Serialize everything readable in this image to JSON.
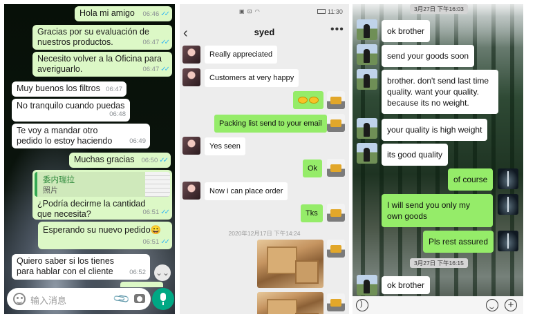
{
  "whatsapp": {
    "messages": [
      {
        "text": "Hola mi amigo",
        "time": "06:46",
        "read": true
      },
      {
        "text": "Gracias por su evaluación de nuestros productos.",
        "time": "06:47",
        "read": true
      },
      {
        "text": "Necesito volver a la Oficina para averiguarlo.",
        "time": "06:47",
        "read": true
      },
      {
        "text": "Muy buenos los filtros",
        "time": "06:47"
      },
      {
        "text": "No tranquilo cuando puedas",
        "time": "06:48"
      },
      {
        "text": "Te voy a mandar otro pedido lo estoy haciendo",
        "time": "06:49"
      },
      {
        "text": "Muchas gracias",
        "time": "06:50",
        "read": true
      },
      {
        "text": "¿Podría decirme la cantidad que necesita?",
        "time": "06:51",
        "read": true,
        "quote_title": "委内瑞拉",
        "quote_sub": "照片"
      },
      {
        "text": "Esperando su nuevo pedido😀",
        "time": "06:51",
        "read": true
      },
      {
        "text": "Quiero saber si los tienes para hablar con el cliente",
        "time": "06:52"
      }
    ],
    "read_ticks": "✓✓",
    "input_placeholder": "输入消息",
    "scroll_down_glyph": "⌄⌄",
    "attach_glyph": "📎",
    "icons": [
      "emoji-icon",
      "paperclip-icon",
      "camera-icon",
      "microphone-icon",
      "scroll-down-icon"
    ],
    "colors": {
      "outgoing_bubble": "#dcf8c6",
      "incoming_bubble": "#ffffff",
      "mic_button": "#00a884",
      "read_ticks": "#34b7f1"
    }
  },
  "wechat": {
    "status_icons": "▣ ⊡ ◠",
    "status_time": "11:30",
    "back_glyph": "‹",
    "title": "syed",
    "more_glyph": "•••",
    "messages": [
      {
        "text": "Really appreciated"
      },
      {
        "text": "Customers at very happy"
      },
      {
        "text": "Packing list send to your email"
      },
      {
        "text": "Yes seen"
      },
      {
        "text": "Ok"
      },
      {
        "text": "Now i can place order"
      },
      {
        "text": "Tks"
      }
    ],
    "timestamp": "2020年12月17日 下午14:24",
    "colors": {
      "outgoing_bubble": "#95ec69",
      "background": "#ededed"
    }
  },
  "wechat_dark": {
    "timestamps": [
      "3月27日 下午16:03",
      "3月27日 下午16:15"
    ],
    "messages": [
      {
        "text": "ok brother"
      },
      {
        "text": "send your goods soon"
      },
      {
        "text": "brother. don't send last time quality. want your quality. because its no weight."
      },
      {
        "text": "your quality is high weight"
      },
      {
        "text": "its good quality"
      },
      {
        "text": "of course"
      },
      {
        "text": "I will send you only my own goods"
      },
      {
        "text": "Pls rest assured"
      },
      {
        "text": "ok brother"
      }
    ],
    "plus_glyph": "+",
    "icons": [
      "voice-icon",
      "emoji-icon",
      "plus-icon"
    ]
  }
}
